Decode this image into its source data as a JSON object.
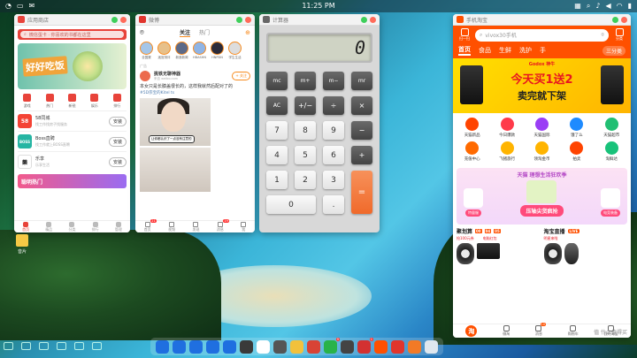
{
  "statusbar": {
    "clock": "11:25 PM",
    "left_icons": [
      "notification-icon",
      "messages-icon",
      "mail-icon"
    ],
    "right_icons": [
      "grid-icon",
      "search-icon",
      "notification-icon",
      "volume-icon",
      "wifi-icon",
      "battery-icon"
    ]
  },
  "appstore": {
    "title": "应用商店",
    "search_placeholder": "微信蛋卡 · 你喜欢的书都在这里",
    "banner_title": "好好吃饭",
    "categories": [
      "游戏",
      "热门",
      "新锐",
      "娱乐",
      "排行"
    ],
    "apps": [
      {
        "logo": "58",
        "name": "58同城",
        "sub": "找工作找房子找服务",
        "action": "安装",
        "color": "#f44335"
      },
      {
        "logo": "BOSS",
        "name": "Boss直聘",
        "sub": "找工作就上BOSS直聘",
        "action": "安装",
        "color": "#26b5a3"
      },
      {
        "logo": "樂",
        "name": "乐享",
        "sub": "乐享生活",
        "action": "安装",
        "color": "#ffffff"
      }
    ],
    "promo": "聪明热门",
    "tabs": [
      "首页",
      "精品",
      "分类",
      "排行",
      "管理"
    ]
  },
  "weibo": {
    "title": "微博",
    "tabs": [
      "关注",
      "热门"
    ],
    "avatars": [
      "全国赛",
      "迷宫测评",
      "新浪新闻",
      "HBASHN",
      "HNPDN",
      "学生生活"
    ],
    "ad_label": "广告",
    "post_name": "挑铁无聊神器",
    "post_source": "来自 weibo.com",
    "post_text": "本女只是长膝盖很长的，这样我就然后配对了的",
    "post_link": "#5D宗宝的Kitel ts",
    "follow_label": "+ 关注",
    "caption": "让你都认识了一点没有注意的",
    "tabs_bottom": [
      "首页",
      "视频",
      "发现",
      "消息",
      "我"
    ],
    "badges": {
      "home": "21",
      "message": "19"
    }
  },
  "calculator": {
    "title": "计算器",
    "display": "0",
    "keys": [
      {
        "label": "mc",
        "kind": "fn"
      },
      {
        "label": "m+",
        "kind": "fn"
      },
      {
        "label": "m−",
        "kind": "fn"
      },
      {
        "label": "mr",
        "kind": "fn"
      },
      {
        "label": "AC",
        "kind": "fn"
      },
      {
        "label": "+/−",
        "kind": "op"
      },
      {
        "label": "÷",
        "kind": "op"
      },
      {
        "label": "×",
        "kind": "op"
      },
      {
        "label": "7",
        "kind": "num"
      },
      {
        "label": "8",
        "kind": "num"
      },
      {
        "label": "9",
        "kind": "num"
      },
      {
        "label": "−",
        "kind": "op"
      },
      {
        "label": "4",
        "kind": "num"
      },
      {
        "label": "5",
        "kind": "num"
      },
      {
        "label": "6",
        "kind": "num"
      },
      {
        "label": "+",
        "kind": "op"
      },
      {
        "label": "1",
        "kind": "num"
      },
      {
        "label": "2",
        "kind": "num"
      },
      {
        "label": "3",
        "kind": "num"
      },
      {
        "label": "=",
        "kind": "equals"
      },
      {
        "label": "0",
        "kind": "num zero"
      },
      {
        "label": ".",
        "kind": "num"
      }
    ]
  },
  "taobao": {
    "title": "手机淘宝",
    "scan_label": "扫一扫",
    "search_placeholder": "vivox30手机",
    "category_label": "分类",
    "nav": [
      "首页",
      "食品",
      "生鲜",
      "洗护",
      "手",
      "三分类"
    ],
    "banner_brand": "Godox 神牛",
    "banner_main": "今天买1送2",
    "banner_sub": "卖完就下架",
    "icons": [
      {
        "label": "天猫新品",
        "color": "#ff4400"
      },
      {
        "label": "今日爆款",
        "color": "#ff3a4a"
      },
      {
        "label": "天猫国际",
        "color": "#9a3ef5"
      },
      {
        "label": "饿了么",
        "color": "#1e8bff"
      },
      {
        "label": "天猫超市",
        "color": "#21bf73"
      },
      {
        "label": "充值中心",
        "color": "#ff6a00"
      },
      {
        "label": "飞猪旅行",
        "color": "#ffb400"
      },
      {
        "label": "领淘金币",
        "color": "#ffb400"
      },
      {
        "label": "拍卖",
        "color": "#ff4400"
      },
      {
        "label": "淘鲜达",
        "color": "#19c27a"
      }
    ],
    "promo_title": "天猫 理想生活狂欢季",
    "promo_left": "特量服",
    "promo_center": "压轴尖货疯抢",
    "promo_right": "电竞装备",
    "deal1_title": "聚划算",
    "deal1_timer": [
      "00",
      "04",
      "05"
    ],
    "deal1_sub": "抢100元券",
    "deal1_sub2": "电脑红包",
    "deal2_title": "淘宝直播",
    "deal2_tag": "LIVE",
    "deal2_sub": "明星来啦",
    "tabs": [
      "淘",
      "微淘",
      "消息",
      "购物车",
      "我的淘宝"
    ],
    "message_badge": "10",
    "watermark": "值 什么值得买"
  },
  "desktop_icon": "音片",
  "dock": [
    {
      "icon": "wave-icon",
      "color": "#1f6fe0"
    },
    {
      "icon": "window-icon",
      "color": "#1f6fe0"
    },
    {
      "icon": "chat-icon",
      "color": "#1f6fe0"
    },
    {
      "icon": "browser-icon",
      "color": "#1f6fe0"
    },
    {
      "icon": "files-icon",
      "color": "#1f6fe0"
    },
    {
      "icon": "terminal-icon",
      "color": "#3a3a3a"
    },
    {
      "icon": "chrome-icon",
      "color": "#ffffff"
    },
    {
      "icon": "calculator-icon",
      "color": "#555555"
    },
    {
      "icon": "notes-icon",
      "color": "#f2c13c"
    },
    {
      "icon": "games-icon",
      "color": "#d84335"
    },
    {
      "icon": "wechat-icon",
      "color": "#29b34a",
      "badge": "9"
    },
    {
      "icon": "lightning-icon",
      "color": "#444444"
    },
    {
      "icon": "red-app-icon",
      "color": "#d33131",
      "badge": "1"
    },
    {
      "icon": "taobao-icon",
      "color": "#ff5000"
    },
    {
      "icon": "weibo-icon",
      "color": "#e1352d"
    },
    {
      "icon": "store-icon",
      "color": "#f27a26"
    },
    {
      "icon": "trash-icon",
      "color": "#dfe7ee"
    }
  ]
}
